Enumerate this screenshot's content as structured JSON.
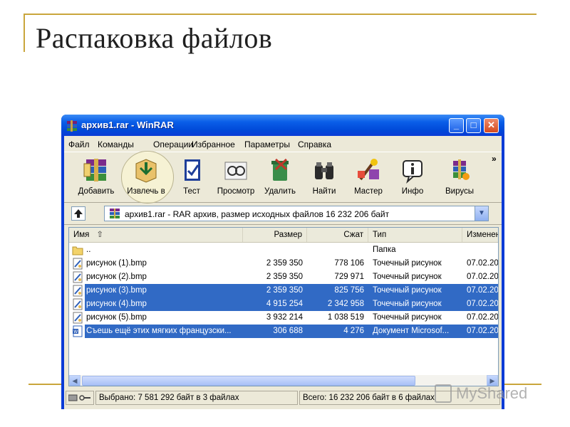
{
  "slide": {
    "title": "Распаковка файлов"
  },
  "window": {
    "title": "архив1.rar - WinRAR",
    "buttons": {
      "minimize": "_",
      "maximize": "□",
      "close": "✕"
    }
  },
  "menu": [
    "Файл",
    "Команды",
    "Операции",
    "Избранное",
    "Параметры",
    "Справка"
  ],
  "toolbar": {
    "items": [
      {
        "label": "Добавить",
        "icon": "add-archive-icon"
      },
      {
        "label": "Извлечь в",
        "icon": "extract-icon"
      },
      {
        "label": "Тест",
        "icon": "test-icon"
      },
      {
        "label": "Просмотр",
        "icon": "view-icon"
      },
      {
        "label": "Удалить",
        "icon": "delete-icon"
      },
      {
        "label": "Найти",
        "icon": "find-icon"
      },
      {
        "label": "Мастер",
        "icon": "wizard-icon"
      },
      {
        "label": "Инфо",
        "icon": "info-icon"
      },
      {
        "label": "Вирусы",
        "icon": "virus-scan-icon"
      }
    ],
    "more": "»"
  },
  "address": {
    "text": "архив1.rar - RAR архив, размер исходных файлов 16 232 206 байт"
  },
  "columns": [
    "Имя",
    "Размер",
    "Сжат",
    "Тип",
    "Изменен"
  ],
  "files": [
    {
      "name": "..",
      "size": "",
      "packed": "",
      "type": "Папка",
      "date": "",
      "selected": false,
      "kind": "folder"
    },
    {
      "name": "рисунок (1).bmp",
      "size": "2 359 350",
      "packed": "778 106",
      "type": "Точечный рисунок",
      "date": "07.02.20",
      "selected": false,
      "kind": "bmp"
    },
    {
      "name": "рисунок (2).bmp",
      "size": "2 359 350",
      "packed": "729 971",
      "type": "Точечный рисунок",
      "date": "07.02.20",
      "selected": false,
      "kind": "bmp"
    },
    {
      "name": "рисунок (3).bmp",
      "size": "2 359 350",
      "packed": "825 756",
      "type": "Точечный рисунок",
      "date": "07.02.20",
      "selected": true,
      "kind": "bmp"
    },
    {
      "name": "рисунок (4).bmp",
      "size": "4 915 254",
      "packed": "2 342 958",
      "type": "Точечный рисунок",
      "date": "07.02.20",
      "selected": true,
      "kind": "bmp"
    },
    {
      "name": "рисунок (5).bmp",
      "size": "3 932 214",
      "packed": "1 038 519",
      "type": "Точечный рисунок",
      "date": "07.02.20",
      "selected": false,
      "kind": "bmp"
    },
    {
      "name": "Съешь ещё этих мягких французски...",
      "size": "306 688",
      "packed": "4 276",
      "type": "Документ Microsof...",
      "date": "07.02.20",
      "selected": true,
      "kind": "doc"
    }
  ],
  "status": {
    "selected": "Выбрано: 7 581 292 байт в 3 файлах",
    "total": "Всего: 16 232 206 байт в 6 файлах"
  },
  "watermark": "MyShared",
  "colors": {
    "selection": "#316ac5",
    "titlebar": "#0a5ee8",
    "slide_accent": "#c9a63c"
  }
}
